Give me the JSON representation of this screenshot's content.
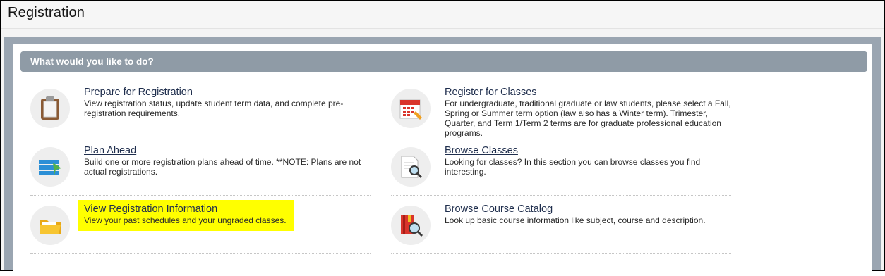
{
  "page": {
    "title": "Registration"
  },
  "section": {
    "title": "What would you like to do?"
  },
  "left_items": [
    {
      "link": "Prepare for Registration",
      "desc": "View registration status, update student term data, and complete pre-registration requirements.",
      "icon": "clipboard-icon"
    },
    {
      "link": "Plan Ahead",
      "desc": "Build one or more registration plans ahead of time. **NOTE: Plans are not actual registrations.",
      "icon": "plan-list-icon"
    },
    {
      "link": "View Registration Information",
      "desc": "View your past schedules and your ungraded classes.",
      "icon": "folder-icon",
      "highlight": "#ffff00"
    }
  ],
  "right_items": [
    {
      "link": "Register for Classes",
      "desc": "For undergraduate, traditional graduate or law students, please select a Fall, Spring or Summer term option (law also has a Winter term). Trimester, Quarter, and Term 1/Term 2 terms are for graduate professional education programs.",
      "icon": "calendar-icon"
    },
    {
      "link": "Browse Classes",
      "desc": "Looking for classes? In this section you can browse classes you find interesting.",
      "icon": "document-search-icon"
    },
    {
      "link": "Browse Course Catalog",
      "desc": "Look up basic course information like subject, course and description.",
      "icon": "catalog-search-icon"
    }
  ],
  "colors": {
    "section_bar": "#8f9ba6",
    "outer_panel": "#9aa5b1",
    "link": "#1f2e4d",
    "highlight": "#ffff00"
  }
}
